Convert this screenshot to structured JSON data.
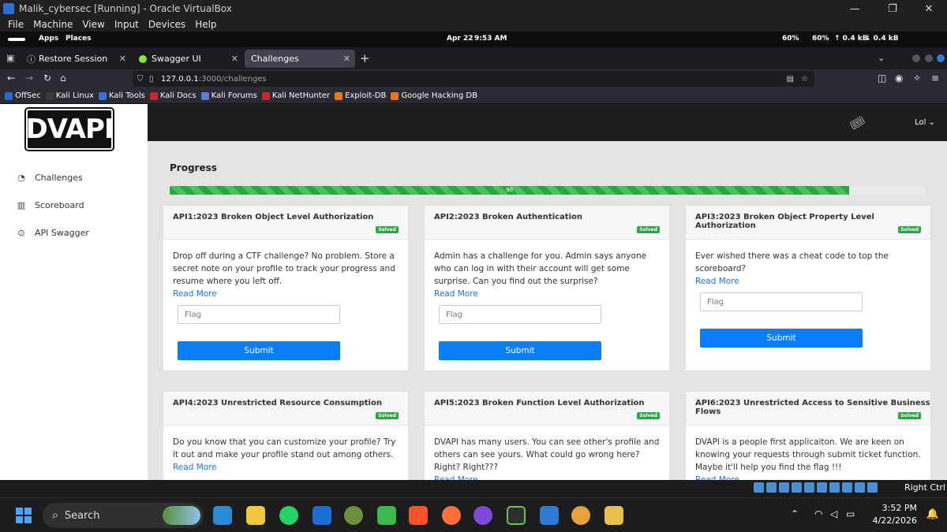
{
  "window": {
    "title": "Malik_cybersec [Running] - Oracle VirtualBox",
    "minimize": "—",
    "maximize": "❐",
    "close": "✕"
  },
  "vb_menu": [
    "File",
    "Machine",
    "View",
    "Input",
    "Devices",
    "Help"
  ],
  "gnome_bar": {
    "apps": "Apps",
    "places": "Places",
    "date": "Apr 22",
    "time": "9:53 AM",
    "battery1": "60%",
    "battery2": "60%",
    "up": "↑ 0.4 kB",
    "down": "↓ 0.4 kB"
  },
  "browser": {
    "tabs": [
      {
        "label": "Restore Session"
      },
      {
        "label": "Swagger UI"
      },
      {
        "label": "Challenges"
      }
    ],
    "new_tab": "+",
    "url_host": "127.0.0.1",
    "url_rest": ":3000/challenges",
    "bookmarks": [
      "OffSec",
      "Kali Linux",
      "Kali Tools",
      "Kali Docs",
      "Kali Forums",
      "Kali NetHunter",
      "Exploit-DB",
      "Google Hacking DB"
    ]
  },
  "app": {
    "logo": "DVAPI",
    "nav": [
      {
        "label": "Challenges"
      },
      {
        "label": "Scoreboard"
      },
      {
        "label": "API Swagger"
      }
    ],
    "user": "Lol ⌄",
    "progress_title": "Progress",
    "progress_value": 90,
    "progress_label": "90",
    "progress_fraction": 0.9,
    "cards": [
      {
        "title": "API1:2023 Broken Object Level Authorization",
        "badge": "Solved",
        "desc": "Drop off during a CTF challenge? No problem. Store a secret note on your profile to track your progress and resume where you left off.",
        "more": "Read More",
        "flag_placeholder": "Flag",
        "submit": "Submit"
      },
      {
        "title": "API2:2023 Broken Authentication",
        "badge": "Solved",
        "desc": "Admin has a challenge for you. Admin says anyone who can log in with their account will get some surprise. Can you find out the surprise?",
        "more": "Read More",
        "flag_placeholder": "Flag",
        "submit": "Submit"
      },
      {
        "title": "API3:2023 Broken Object Property Level Authorization",
        "badge": "Solved",
        "desc": "Ever wished there was a cheat code to top the scoreboard?",
        "more": "Read More",
        "flag_placeholder": "Flag",
        "submit": "Submit"
      },
      {
        "title": "API4:2023 Unrestricted Resource Consumption",
        "badge": "Solved",
        "desc": "Do you know that you can customize your profile? Try it out and make your profile stand out among others.",
        "more": "Read More"
      },
      {
        "title": "API5:2023 Broken Function Level Authorization",
        "badge": "Solved",
        "desc": "DVAPI has many users. You can see other's profile and others can see yours. What could go wrong here? Right? Right???",
        "more": "Read More"
      },
      {
        "title": "API6:2023 Unrestricted Access to Sensitive Business Flows",
        "badge": "Solved",
        "desc": "DVAPI is a people first applicaiton. We are keen on knowing your requests through submit ticket function. Maybe it'll help you find the flag !!!",
        "more": "Read More"
      }
    ]
  },
  "vb_status": {
    "host_key": "Right Ctrl"
  },
  "taskbar": {
    "search": "Search",
    "time": "3:52 PM",
    "date": "4/22/2026"
  }
}
